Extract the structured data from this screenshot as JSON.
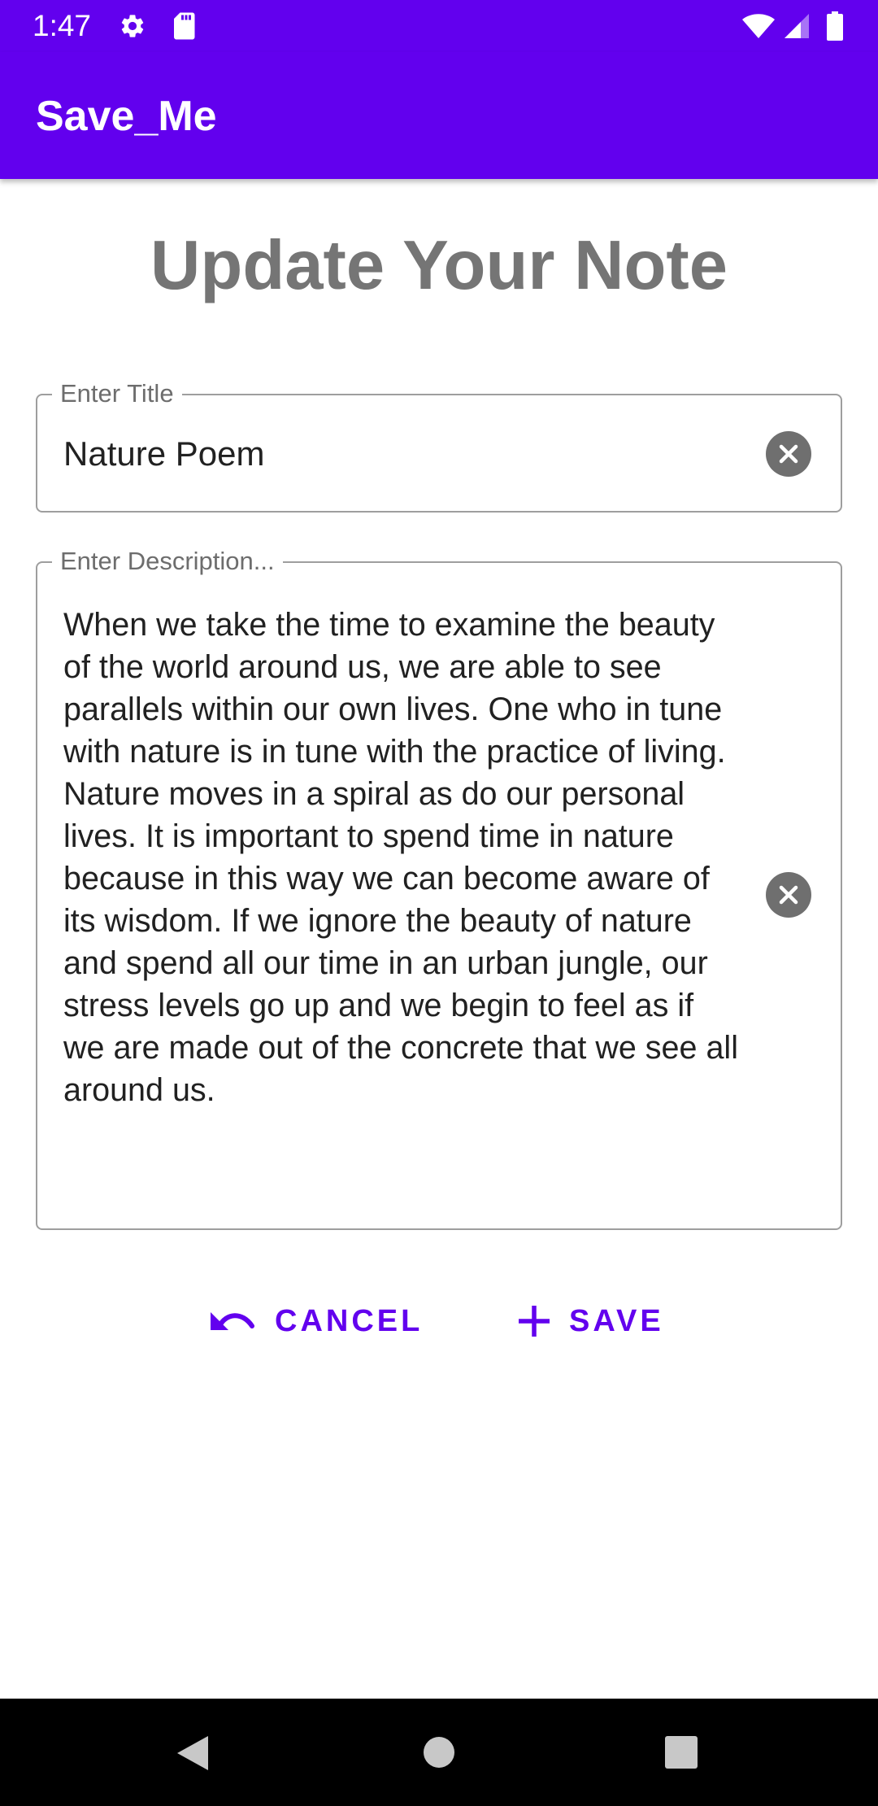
{
  "status_bar": {
    "time": "1:47",
    "icons": [
      "gear-icon",
      "sd-card-icon",
      "wifi-icon",
      "signal-icon",
      "battery-icon"
    ]
  },
  "app_bar": {
    "title": "Save_Me",
    "color": "#6200EE"
  },
  "page": {
    "heading": "Update Your Note"
  },
  "title_field": {
    "label": "Enter Title",
    "value": "Nature Poem",
    "clear_icon": "clear-icon"
  },
  "description_field": {
    "label": "Enter Description...",
    "value": "When we take the time to examine the beauty of the world around us, we are able to see parallels within our own lives. One who in tune with nature is in tune with the practice of living. Nature moves in a spiral as do our personal lives. It is important to spend time in nature because in this way we can become aware of its wisdom. If we ignore the beauty of nature and spend all our time in an urban jungle, our stress levels go up and we begin to feel as if we are made out of the concrete that we see all around us.",
    "clear_icon": "clear-icon"
  },
  "actions": {
    "cancel_label": "CANCEL",
    "cancel_icon": "undo-icon",
    "save_label": "SAVE",
    "save_icon": "plus-icon"
  },
  "nav_bar": {
    "icons": [
      "back-icon",
      "home-icon",
      "recents-icon"
    ]
  }
}
